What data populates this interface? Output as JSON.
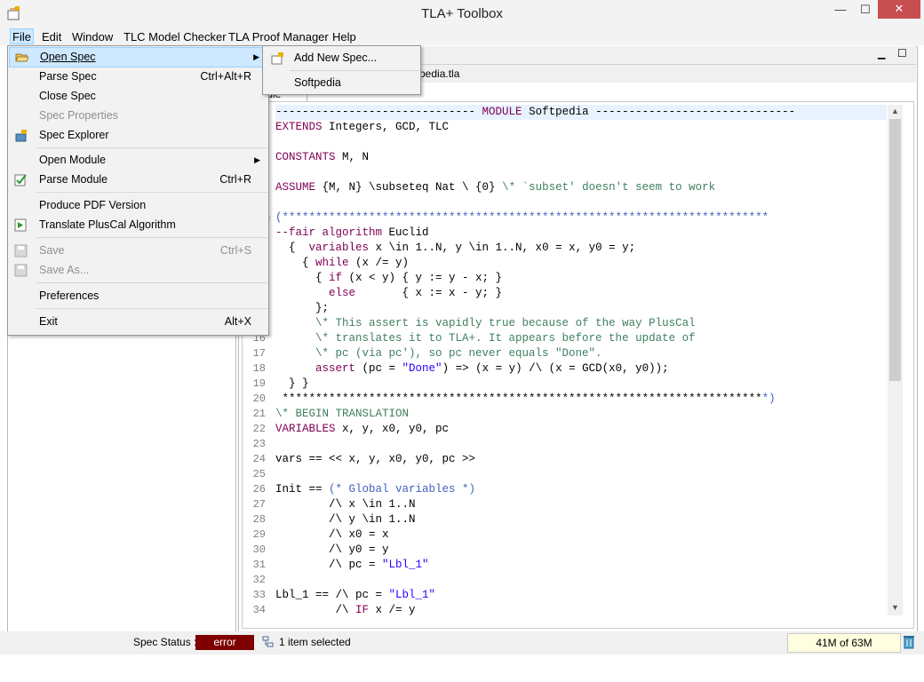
{
  "window": {
    "title": "TLA+ Toolbox",
    "minimize": "—",
    "maximize": "☐",
    "close": "✕"
  },
  "menubar": {
    "items": [
      "File",
      "Edit",
      "Window",
      "TLC Model Checker",
      "TLA Proof Manager",
      "Help"
    ]
  },
  "file_menu": {
    "items": [
      {
        "label": "Open Spec",
        "accel": "",
        "submenu": true
      },
      {
        "label": "Parse Spec",
        "accel": "Ctrl+Alt+R"
      },
      {
        "label": "Close Spec",
        "accel": ""
      },
      {
        "label": "Spec Properties",
        "accel": ""
      },
      {
        "label": "Spec Explorer",
        "accel": ""
      },
      {
        "label": "Open Module",
        "accel": "",
        "submenu": true
      },
      {
        "label": "Parse Module",
        "accel": "Ctrl+R"
      },
      {
        "label": "Produce PDF Version",
        "accel": ""
      },
      {
        "label": "Translate PlusCal Algorithm",
        "accel": ""
      },
      {
        "label": "Save",
        "accel": "Ctrl+S"
      },
      {
        "label": "Save As...",
        "accel": ""
      },
      {
        "label": "Preferences",
        "accel": ""
      },
      {
        "label": "Exit",
        "accel": "Alt+X"
      }
    ]
  },
  "open_spec_submenu": {
    "items": [
      "Add New Spec...",
      "Softpedia"
    ]
  },
  "editor": {
    "file_tab": "pedia.tla",
    "sub_tab": "Module",
    "line_numbers": [
      "16",
      "17",
      "18",
      "19",
      "20",
      "21",
      "22",
      "23",
      "24",
      "25",
      "26",
      "27",
      "28",
      "29",
      "30",
      "31",
      "32",
      "33",
      "34"
    ]
  },
  "code": {
    "l01a": "------------------------------ ",
    "l01b": "MODULE",
    "l01c": " Softpedia ------------------------------",
    "l02a": "EXTENDS",
    "l02b": " Integers, GCD, TLC",
    "l04a": "CONSTANTS",
    "l04b": " M, N",
    "l06a": "ASSUME",
    "l06b": " {M, N} \\subseteq Nat \\ {0} ",
    "l06c": "\\* `subset' doesn't seem to work",
    "l08": "(*************************************************************************",
    "l09a": "--fair algorithm",
    "l09b": " Euclid",
    "l10a": "  {  ",
    "l10b": "variables",
    "l10c": " x \\in 1..N, y \\in 1..N, x0 = x, y0 = y;",
    "l11a": "    { ",
    "l11b": "while",
    "l11c": " (x /= y)",
    "l12a": "      { ",
    "l12b": "if",
    "l12c": " (x < y) { y := y - x; }",
    "l13a": "        ",
    "l13b": "else",
    "l13c": "       { x := x - y; }",
    "l14": "      };",
    "l15a": "      ",
    "l15b": "\\* This assert is vapidly true because of the way PlusCal",
    "l16": "      \\* translates it to TLA+. It appears before the update of",
    "l17": "      \\* pc (via pc'), so pc never equals \"Done\".",
    "l18a": "      ",
    "l18b": "assert",
    "l18c": " (pc = ",
    "l18d": "\"Done\"",
    "l18e": ") => (x = y) /\\ (x = GCD(x0, y0));",
    "l19": "  } }",
    "l20a": " ************************************************************************",
    "l20b": "*)",
    "l21": "\\* BEGIN TRANSLATION",
    "l22a": "VARIABLES",
    "l22b": " x, y, x0, y0, pc",
    "l24": "vars == << x, y, x0, y0, pc >>",
    "l26a": "Init == ",
    "l26b": "(* Global variables *)",
    "l27": "        /\\ x \\in 1..N",
    "l28": "        /\\ y \\in 1..N",
    "l29": "        /\\ x0 = x",
    "l30": "        /\\ y0 = y",
    "l31a": "        /\\ pc = ",
    "l31b": "\"Lbl_1\"",
    "l33a": "Lbl_1 == /\\ pc = ",
    "l33b": "\"Lbl_1\"",
    "l34a": "         /\\ ",
    "l34b": "IF",
    "l34c": " x /= y"
  },
  "status": {
    "spec_status_label": "Spec Status :",
    "spec_status_value": "error",
    "selection": "1 item selected",
    "memory": "41M of 63M"
  },
  "colors": {
    "status_error": "#7f0000",
    "menu_highlight": "#cde8ff",
    "keyword": "#7f0055",
    "comment": "#3f7f5f",
    "block_comment": "#3f5fbf",
    "string": "#2a00ff"
  }
}
